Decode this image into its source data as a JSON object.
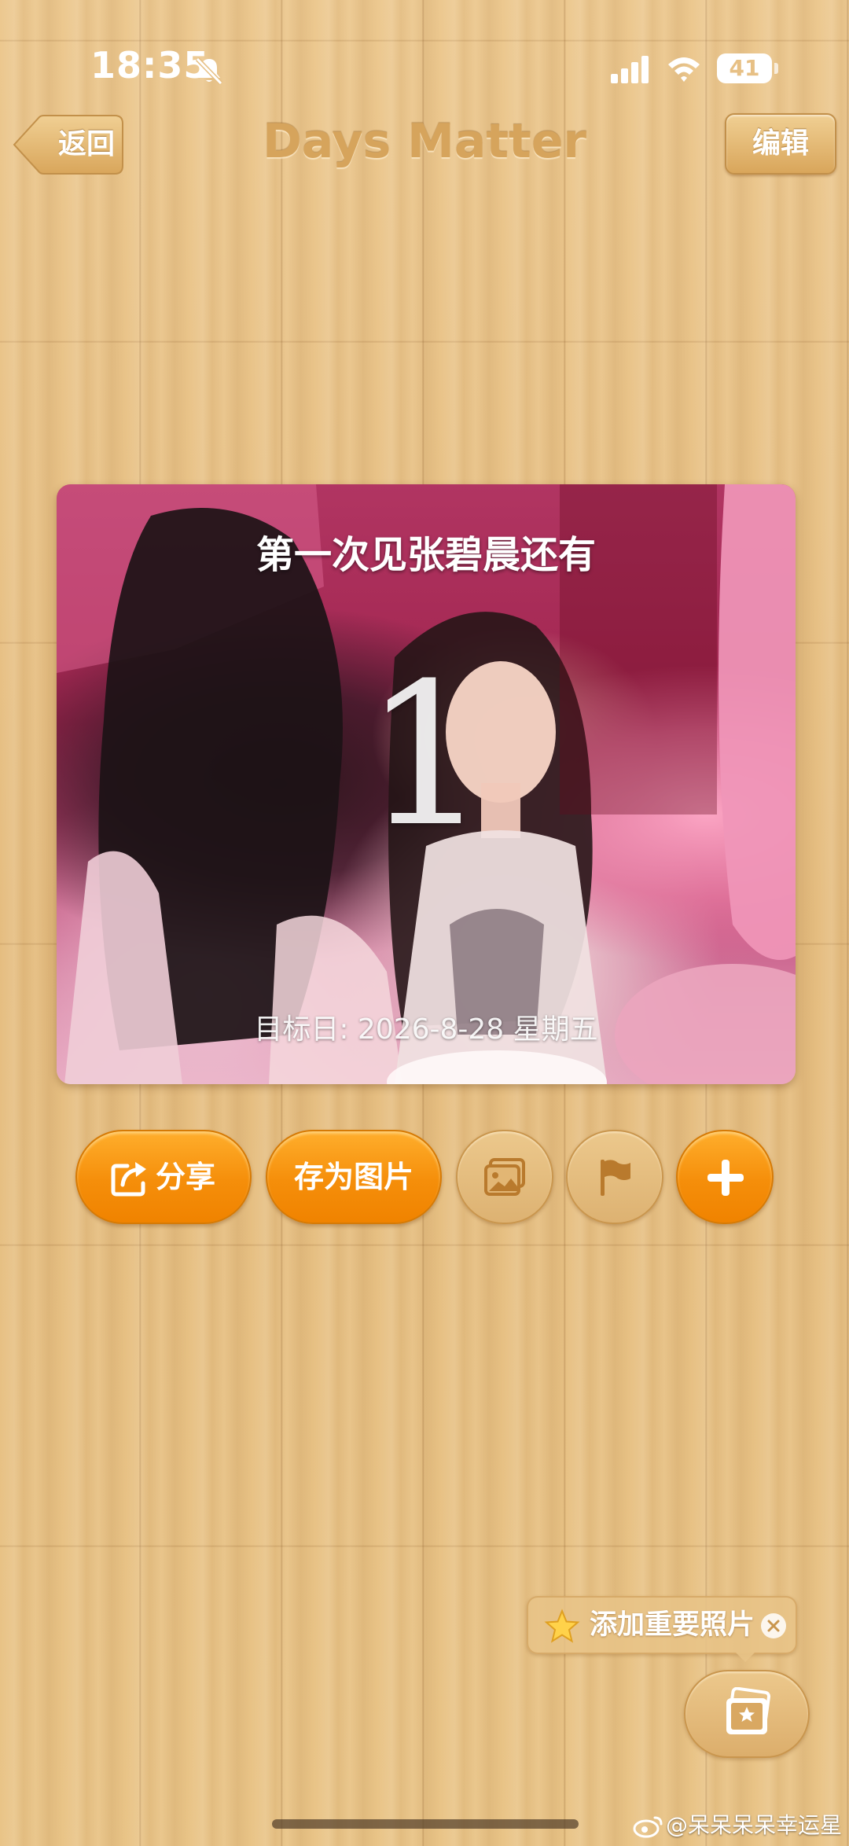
{
  "status_bar": {
    "time": "18:35",
    "battery": "41",
    "icons": [
      "bell-slash-icon",
      "signal-icon",
      "wifi-icon",
      "battery-icon"
    ]
  },
  "nav": {
    "back_label": "返回",
    "title": "Days Matter",
    "edit_label": "编辑"
  },
  "event": {
    "title": "第一次见张碧晨还有",
    "days": "1",
    "target_date": "目标日: 2026-8-28 星期五"
  },
  "actions": {
    "share_label": "分享",
    "save_image_label": "存为图片",
    "gallery_icon": "photo-gallery-icon",
    "flag_icon": "flag-icon",
    "add_icon": "plus-icon"
  },
  "tip": {
    "label": "添加重要照片",
    "icon": "star-icon"
  },
  "watermark": {
    "text": "@呆呆呆呆幸运星"
  },
  "colors": {
    "accent_orange": "#f58e0a",
    "wood_base": "#e7c085",
    "title_text": "#d6a45c"
  }
}
